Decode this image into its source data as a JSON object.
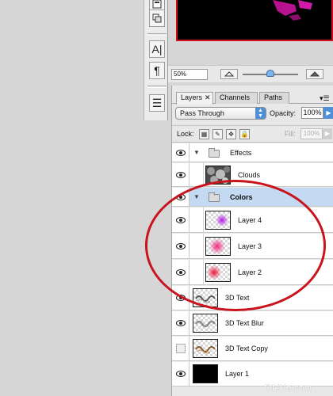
{
  "navigator": {
    "zoom_value": "50%"
  },
  "tools": {
    "items": [
      {
        "name": "type-tool",
        "glyph": "A|"
      },
      {
        "name": "paragraph-tool",
        "glyph": "¶"
      },
      {
        "name": "notes-tool",
        "glyph": "☰"
      }
    ]
  },
  "layers_panel": {
    "tabs": [
      {
        "label": "Layers",
        "active": true,
        "closable": true
      },
      {
        "label": "Channels",
        "active": false
      },
      {
        "label": "Paths",
        "active": false
      }
    ],
    "blend_mode": "Pass Through",
    "opacity_label": "Opacity:",
    "opacity_value": "100%",
    "lock_label": "Lock:",
    "fill_label": "Fill:",
    "fill_value": "100%",
    "layers": [
      {
        "name": "Effects",
        "type": "group",
        "visible": true,
        "selected": false
      },
      {
        "name": "Clouds",
        "type": "layer",
        "visible": true,
        "in_group": true,
        "thumb": "clouds"
      },
      {
        "name": "Colors",
        "type": "group",
        "visible": true,
        "selected": true
      },
      {
        "name": "Layer 4",
        "type": "layer",
        "visible": true,
        "in_group": true,
        "thumb": "purple-glow"
      },
      {
        "name": "Layer 3",
        "type": "layer",
        "visible": true,
        "in_group": true,
        "thumb": "pink-glow"
      },
      {
        "name": "Layer 2",
        "type": "layer",
        "visible": true,
        "in_group": true,
        "thumb": "red-glow"
      },
      {
        "name": "3D Text",
        "type": "layer",
        "visible": true,
        "thumb": "text"
      },
      {
        "name": "3D Text Blur",
        "type": "layer",
        "visible": true,
        "thumb": "text"
      },
      {
        "name": "3D Text Copy",
        "type": "layer",
        "visible": false,
        "thumb": "text-brown"
      },
      {
        "name": "Layer 1",
        "type": "layer",
        "visible": true,
        "thumb": "black"
      }
    ]
  },
  "watermark": "OLiHe.com",
  "colors": {
    "accent": "#4f8fd6",
    "selection": "#c4d9f2",
    "annotation": "#c8141c",
    "canvas_border": "#d0101a"
  }
}
